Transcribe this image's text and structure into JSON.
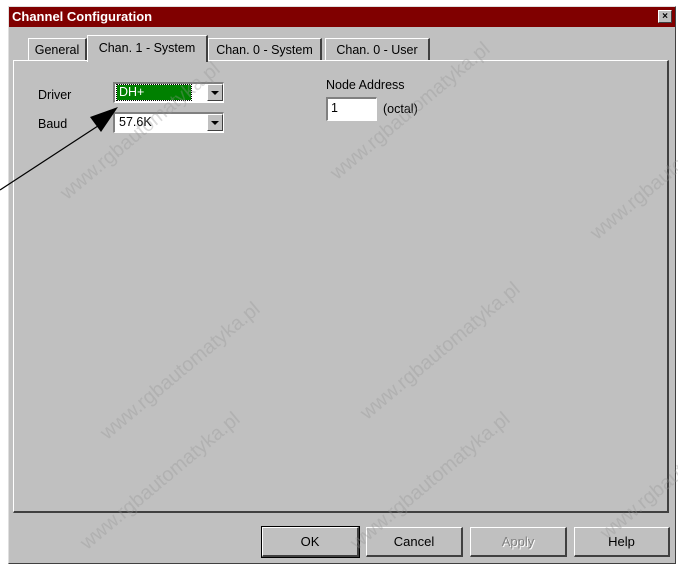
{
  "window": {
    "title": "Channel Configuration",
    "close_label": "×"
  },
  "tabs": [
    {
      "label": "General",
      "active": false
    },
    {
      "label": "Chan. 1 - System",
      "active": true
    },
    {
      "label": "Chan. 0 - System",
      "active": false
    },
    {
      "label": "Chan. 0 - User",
      "active": false
    }
  ],
  "form": {
    "driver_label": "Driver",
    "driver_value": "DH+",
    "baud_label": "Baud",
    "baud_value": "57.6K",
    "node_address_label": "Node Address",
    "node_address_value": "1",
    "node_address_unit": "(octal)"
  },
  "buttons": {
    "ok": "OK",
    "cancel": "Cancel",
    "apply": "Apply",
    "help": "Help"
  },
  "watermark": "www.rgbautomatyka.pl",
  "colors": {
    "title_bar": "#800000",
    "selection": "#008000",
    "face": "#c0c0c0"
  }
}
